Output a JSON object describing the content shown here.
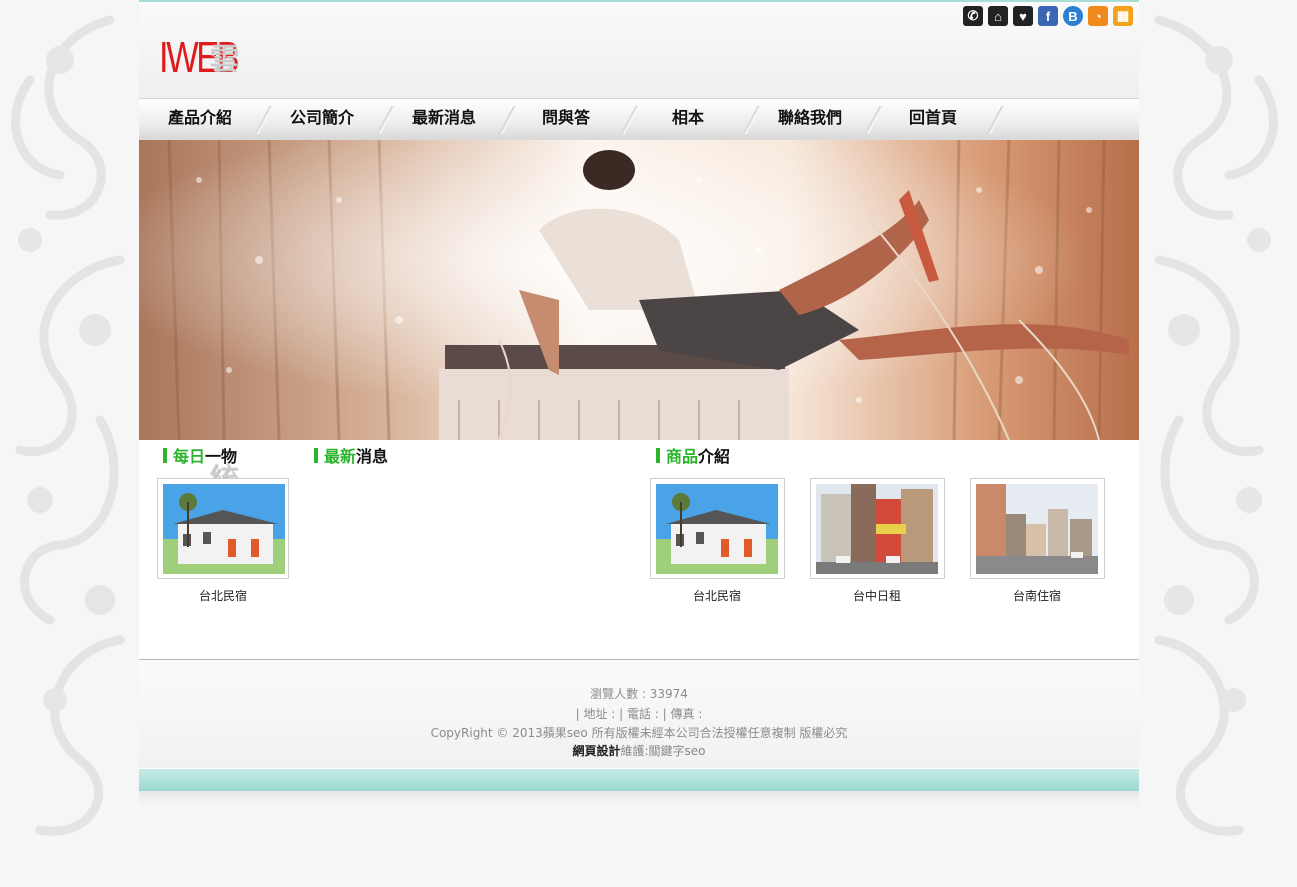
{
  "site": {
    "logo_red": "IWEB",
    "logo_gray": "雲端主機管理系統"
  },
  "social_icons": [
    {
      "name": "phone-icon",
      "glyph": "✆",
      "bg": "#222222"
    },
    {
      "name": "home-icon",
      "glyph": "⌂",
      "bg": "#222222"
    },
    {
      "name": "heart-icon",
      "glyph": "♥",
      "bg": "#222222"
    },
    {
      "name": "facebook-icon",
      "glyph": "f",
      "bg": "#3b66b3"
    },
    {
      "name": "blogger-icon",
      "glyph": "B",
      "bg": "#2c7fd1"
    },
    {
      "name": "rss-icon",
      "glyph": "◔",
      "bg": "#f08a1c"
    },
    {
      "name": "share-icon",
      "glyph": "▦",
      "bg": "#f3a21a"
    }
  ],
  "nav": {
    "items": [
      "產品介紹",
      "公司簡介",
      "最新消息",
      "問與答",
      "相本",
      "聯絡我們",
      "回首頁"
    ]
  },
  "sections": {
    "daily": {
      "green": "每日",
      "black": "一物"
    },
    "news": {
      "green": "最新",
      "black": "消息"
    },
    "products": {
      "green": "商品",
      "black": "介紹"
    }
  },
  "daily_item": {
    "caption": "台北民宿"
  },
  "products": [
    {
      "caption": "台北民宿"
    },
    {
      "caption": "台中日租"
    },
    {
      "caption": "台南住宿"
    }
  ],
  "footer": {
    "visitors": "瀏覽人數 : 33974",
    "contact": "| 地址 :  | 電話 :  | 傳真 :",
    "copyright": "CopyRight © 2013蘋果seo 所有版權未經本公司合法授權任意複制 版權必究",
    "design_bold": "網頁設計",
    "design_rest": "維護:關鍵字seo"
  },
  "colors": {
    "accent_green": "#2bb52b",
    "logo_red": "#e01b1b",
    "band_teal": "#9ad9d0"
  }
}
